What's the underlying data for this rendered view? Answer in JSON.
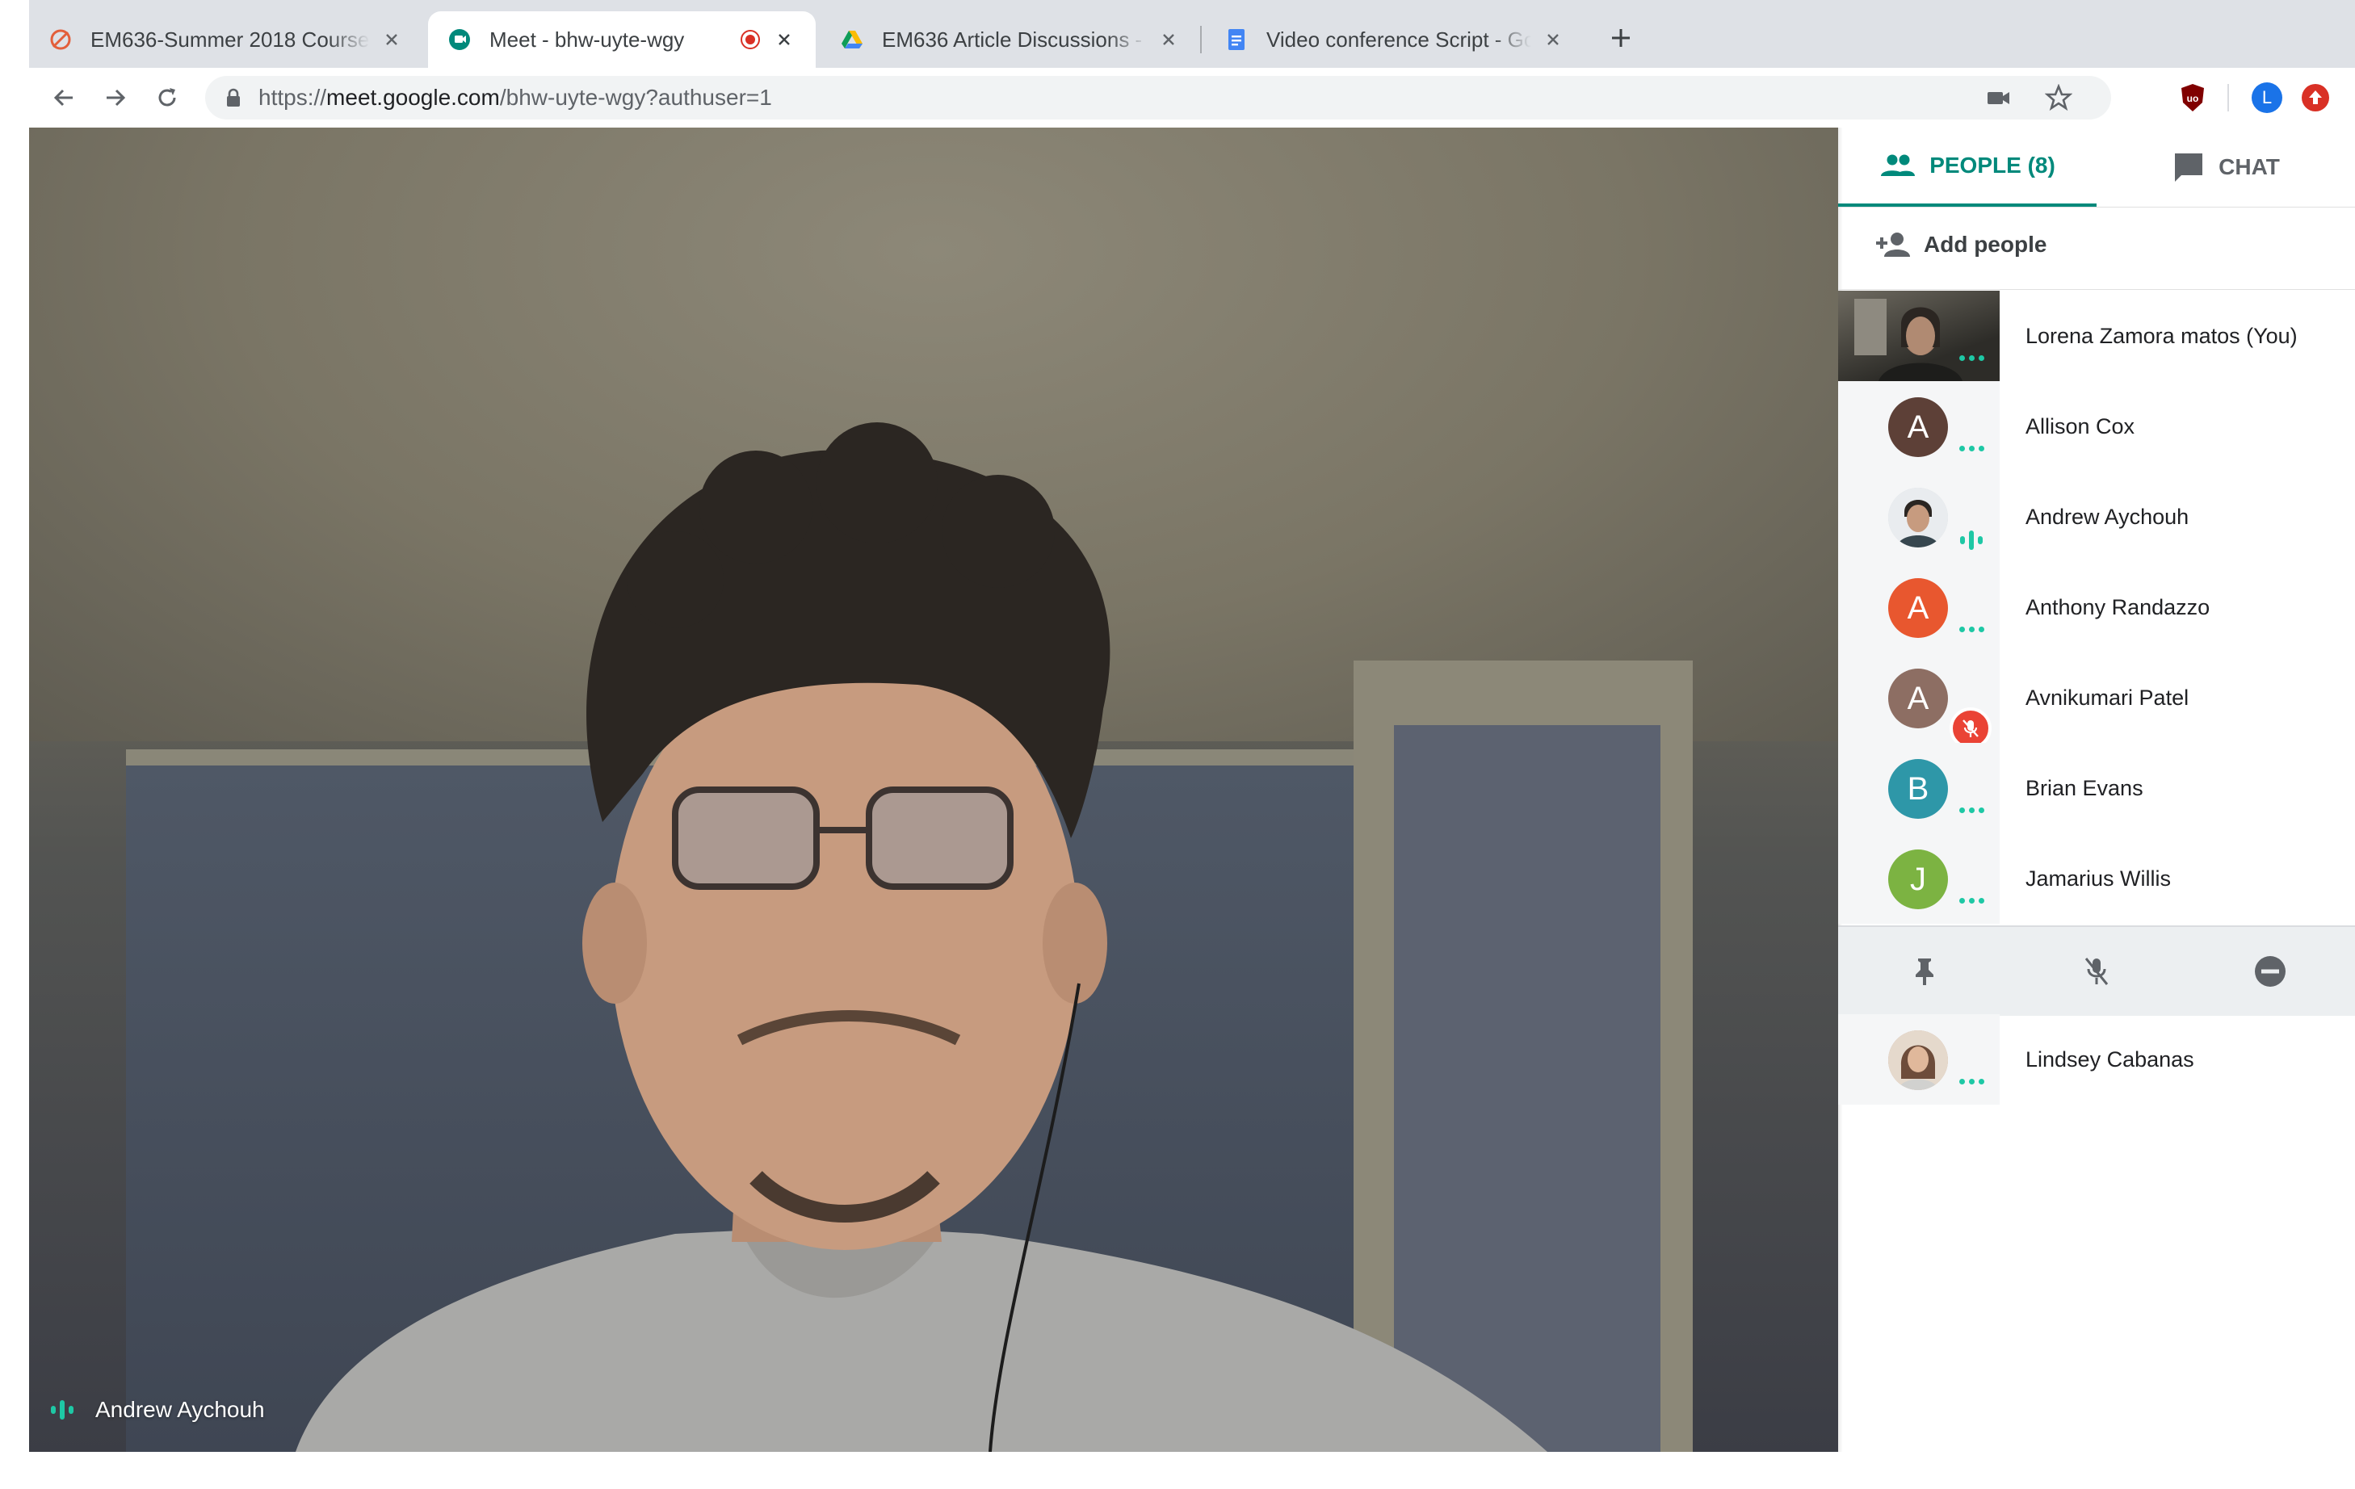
{
  "tabs": [
    {
      "title": "EM636-Summer 2018 Course",
      "icon": "canvas-icon",
      "active": false
    },
    {
      "title": "Meet - bhw-uyte-wgy",
      "icon": "meet-icon",
      "active": true,
      "recording": true
    },
    {
      "title": "EM636 Article Discussions - G",
      "icon": "drive-icon",
      "active": false
    },
    {
      "title": "Video conference Script - Goo",
      "icon": "docs-icon",
      "active": false
    }
  ],
  "url": {
    "scheme": "https://",
    "host": "meet.google.com",
    "path": "/bhw-uyte-wgy?authuser=1"
  },
  "profile_initial": "L",
  "stage": {
    "speaker_name": "Andrew Aychouh"
  },
  "panel": {
    "people_tab_label": "PEOPLE (8)",
    "chat_tab_label": "CHAT",
    "add_people_label": "Add people",
    "participants": [
      {
        "name": "Lorena Zamora matos (You)",
        "initial": "",
        "color": "",
        "status": "dots",
        "avatar": "video-thumbnail"
      },
      {
        "name": "Allison Cox",
        "initial": "A",
        "color": "#5d4037",
        "status": "dots"
      },
      {
        "name": "Andrew Aychouh",
        "initial": "",
        "color": "#cfd8dc",
        "status": "speaking",
        "avatar": "photo"
      },
      {
        "name": "Anthony Randazzo",
        "initial": "A",
        "color": "#e8572f",
        "status": "dots"
      },
      {
        "name": "Avnikumari Patel",
        "initial": "A",
        "color": "#8d6e63",
        "status": "muted"
      },
      {
        "name": "Brian Evans",
        "initial": "B",
        "color": "#2e97a8",
        "status": "dots"
      },
      {
        "name": "Jamarius Willis",
        "initial": "J",
        "color": "#7cb342",
        "status": "dots"
      },
      {
        "name": "Lindsey Cabanas",
        "initial": "",
        "color": "#c9a38a",
        "status": "dots",
        "avatar": "photo"
      }
    ],
    "row_actions": [
      "pin-icon",
      "mic-off-icon",
      "remove-icon"
    ],
    "accent_color": "#00897b"
  }
}
